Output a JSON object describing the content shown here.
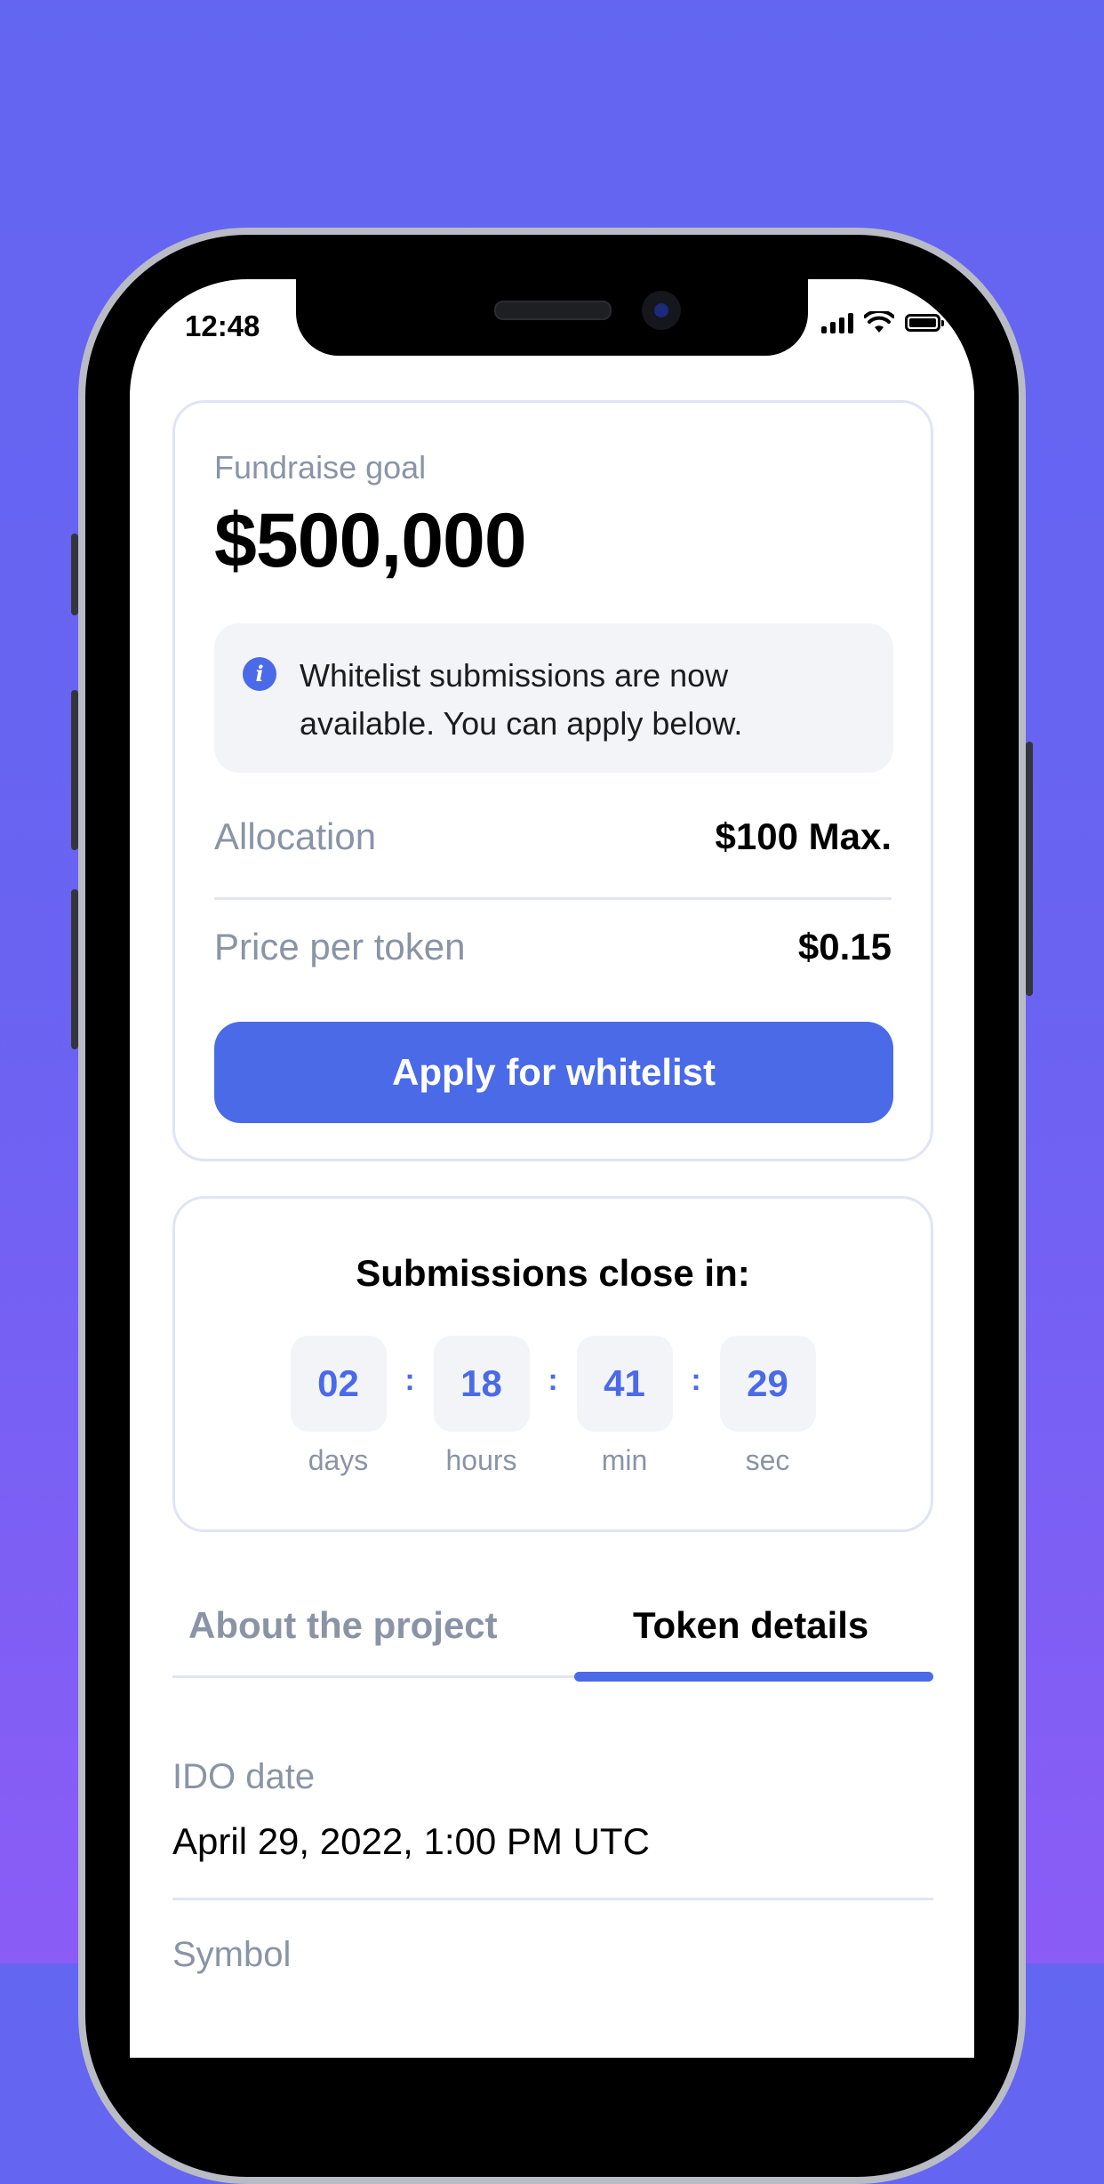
{
  "status_bar": {
    "time": "12:48"
  },
  "fundraise": {
    "label": "Fundraise goal",
    "value": "$500,000"
  },
  "info": {
    "icon": "i",
    "text": "Whitelist submissions are now available. You can apply below."
  },
  "allocation": {
    "label": "Allocation",
    "value": "$100 Max."
  },
  "price": {
    "label": "Price per token",
    "value": "$0.15"
  },
  "apply_button": {
    "label": "Apply for whitelist"
  },
  "countdown": {
    "title": "Submissions close in:",
    "separator": ":",
    "units": [
      {
        "value": "02",
        "label": "days"
      },
      {
        "value": "18",
        "label": "hours"
      },
      {
        "value": "41",
        "label": "min"
      },
      {
        "value": "29",
        "label": "sec"
      }
    ]
  },
  "tabs": {
    "about": "About the project",
    "token": "Token details",
    "active": "Token details"
  },
  "details": [
    {
      "label": "IDO date",
      "value": "April 29, 2022, 1:00 PM UTC"
    },
    {
      "label": "Symbol",
      "value": ""
    }
  ],
  "colors": {
    "background_top": "#6366f1",
    "background_bottom": "#8b5cf6",
    "accent": "#4a6ae8",
    "muted_text": "#8a94a6",
    "border": "#e0e4f6"
  }
}
